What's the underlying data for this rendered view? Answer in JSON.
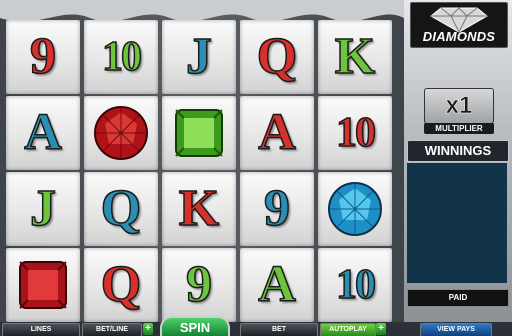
{
  "game": {
    "logo_text": "DIAMONDS",
    "multiplier": {
      "value": "x1",
      "label": "MULTIPLIER"
    },
    "winnings_label": "WINNINGS",
    "paid_label": "PAID"
  },
  "reels": [
    [
      {
        "text": "9",
        "color": "red"
      },
      {
        "text": "A",
        "color": "blue"
      },
      {
        "text": "J",
        "color": "green"
      },
      {
        "gem": "red-square"
      }
    ],
    [
      {
        "text": "10",
        "color": "green"
      },
      {
        "gem": "red-round"
      },
      {
        "text": "Q",
        "color": "blue"
      },
      {
        "text": "Q",
        "color": "red"
      }
    ],
    [
      {
        "text": "J",
        "color": "blue"
      },
      {
        "gem": "green-square"
      },
      {
        "text": "K",
        "color": "red"
      },
      {
        "text": "9",
        "color": "green"
      }
    ],
    [
      {
        "text": "Q",
        "color": "red"
      },
      {
        "text": "A",
        "color": "red"
      },
      {
        "text": "9",
        "color": "blue"
      },
      {
        "text": "A",
        "color": "green"
      }
    ],
    [
      {
        "text": "K",
        "color": "green"
      },
      {
        "text": "10",
        "color": "red"
      },
      {
        "gem": "blue-round"
      },
      {
        "text": "10",
        "color": "blue"
      }
    ]
  ],
  "controls": {
    "lines_label": "LINES",
    "bet_line_label": "BET/LINE",
    "spin_label": "SPIN",
    "bet_label": "BET",
    "autoplay_label": "AUTOPLAY",
    "view_pays_label": "VIEW PAYS",
    "plus_label": "+"
  },
  "colors": {
    "red": "#d8302b",
    "blue": "#2a8fb2",
    "green": "#6cc53b",
    "spin_green": "#1aa445",
    "winnings_bg": "#123449",
    "view_pays_blue": "#1f5ea6"
  }
}
